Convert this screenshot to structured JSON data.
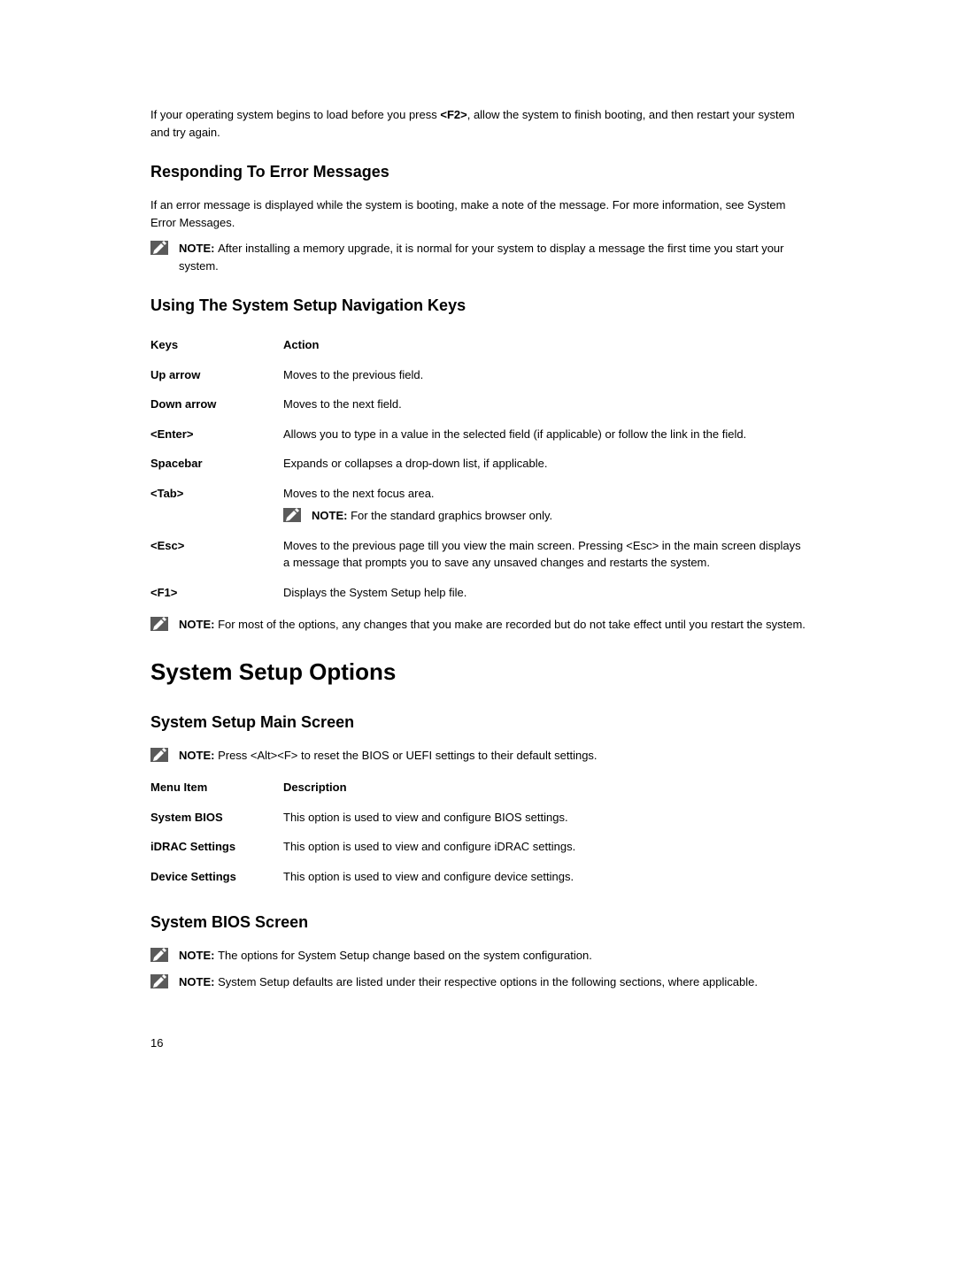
{
  "intro": {
    "text_before": "If your operating system begins to load before you press ",
    "key": "<F2>",
    "text_after": ", allow the system to finish booting, and then restart your system and try again."
  },
  "responding": {
    "heading": "Responding To Error Messages",
    "para": "If an error message is displayed while the system is booting, make a note of the message. For more information, see System Error Messages.",
    "note_label": "NOTE: ",
    "note_text": "After installing a memory upgrade, it is normal for your system to display a message the first time you start your system."
  },
  "navkeys": {
    "heading": "Using The System Setup Navigation Keys",
    "header_key": "Keys",
    "header_action": "Action",
    "rows": {
      "up": {
        "k": "Up arrow",
        "v": "Moves to the previous field."
      },
      "down": {
        "k": "Down arrow",
        "v": "Moves to the next field."
      },
      "enter": {
        "k": "<Enter>",
        "v": "Allows you to type in a value in the selected field (if applicable) or follow the link in the field."
      },
      "spacebar": {
        "k": "Spacebar",
        "v": "Expands or collapses a drop-down list, if applicable."
      },
      "tab": {
        "k": "<Tab>",
        "v": "Moves to the next focus area.",
        "note_label": "NOTE: ",
        "note_text": "For the standard graphics browser only."
      },
      "esc": {
        "k": "<Esc>",
        "v": "Moves to the previous page till you view the main screen. Pressing <Esc> in the main screen displays a message that prompts you to save any unsaved changes and restarts the system."
      },
      "f1": {
        "k": "<F1>",
        "v": "Displays the System Setup help file."
      }
    },
    "footer_note_label": "NOTE: ",
    "footer_note_text": "For most of the options, any changes that you make are recorded but do not take effect until you restart the system."
  },
  "setup_options": {
    "heading": "System Setup Options"
  },
  "main_screen": {
    "heading": "System Setup Main Screen",
    "note_label": "NOTE: ",
    "note_text": "Press <Alt><F> to reset the BIOS or UEFI settings to their default settings.",
    "header_item": "Menu Item",
    "header_desc": "Description",
    "rows": {
      "bios": {
        "k": "System BIOS",
        "v": "This option is used to view and configure BIOS settings."
      },
      "idrac": {
        "k": "iDRAC Settings",
        "v": "This option is used to view and configure iDRAC settings."
      },
      "device": {
        "k": "Device Settings",
        "v": "This option is used to view and configure device settings."
      }
    }
  },
  "bios_screen": {
    "heading": "System BIOS Screen",
    "note1_label": "NOTE: ",
    "note1_text": "The options for System Setup change based on the system configuration.",
    "note2_label": "NOTE: ",
    "note2_text": "System Setup defaults are listed under their respective options in the following sections, where applicable."
  },
  "page_number": "16"
}
